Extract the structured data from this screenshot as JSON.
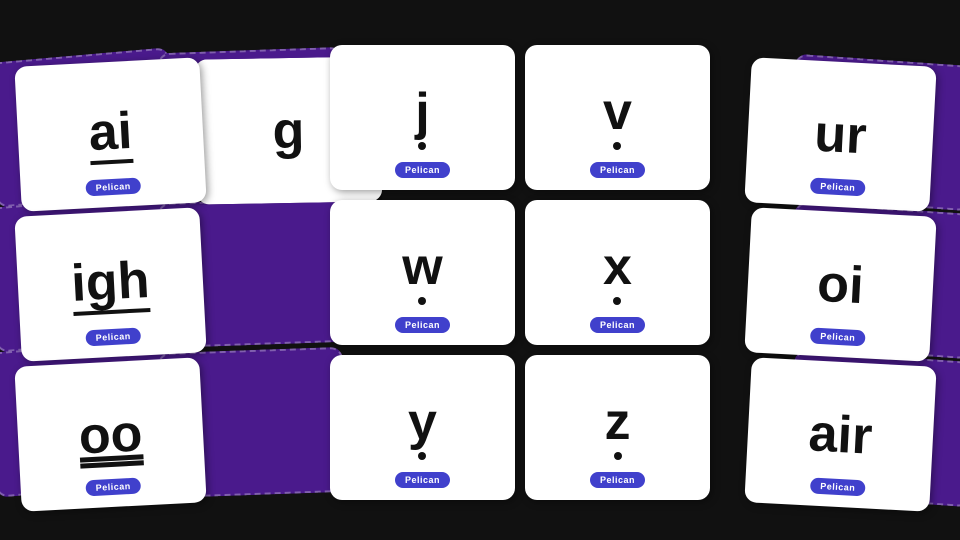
{
  "background": "#111111",
  "purple": "#4a1a8c",
  "brand": {
    "logo_label": "Pelican",
    "color": "#4040cc"
  },
  "cards": [
    {
      "id": "ai",
      "text": "ai",
      "style": "underlined",
      "col": 1,
      "row": 1
    },
    {
      "id": "igh",
      "text": "igh",
      "style": "underlined",
      "col": 1,
      "row": 2
    },
    {
      "id": "oo",
      "text": "oo",
      "style": "double-underlined",
      "col": 1,
      "row": 3
    },
    {
      "id": "g",
      "text": "g",
      "style": "plain",
      "col": 2,
      "row": 1
    },
    {
      "id": "j",
      "text": "j",
      "style": "dot",
      "col": 3,
      "row": 1
    },
    {
      "id": "w",
      "text": "w",
      "style": "dot",
      "col": 3,
      "row": 2
    },
    {
      "id": "y",
      "text": "y",
      "style": "dot",
      "col": 3,
      "row": 3
    },
    {
      "id": "v",
      "text": "v",
      "style": "dot",
      "col": 4,
      "row": 1
    },
    {
      "id": "x",
      "text": "x",
      "style": "dot",
      "col": 4,
      "row": 2
    },
    {
      "id": "z",
      "text": "z",
      "style": "dot",
      "col": 4,
      "row": 3
    },
    {
      "id": "ur",
      "text": "ur",
      "style": "plain",
      "col": 5,
      "row": 1
    },
    {
      "id": "oi",
      "text": "oi",
      "style": "plain",
      "col": 5,
      "row": 2
    },
    {
      "id": "air",
      "text": "air",
      "style": "plain",
      "col": 5,
      "row": 3
    }
  ]
}
